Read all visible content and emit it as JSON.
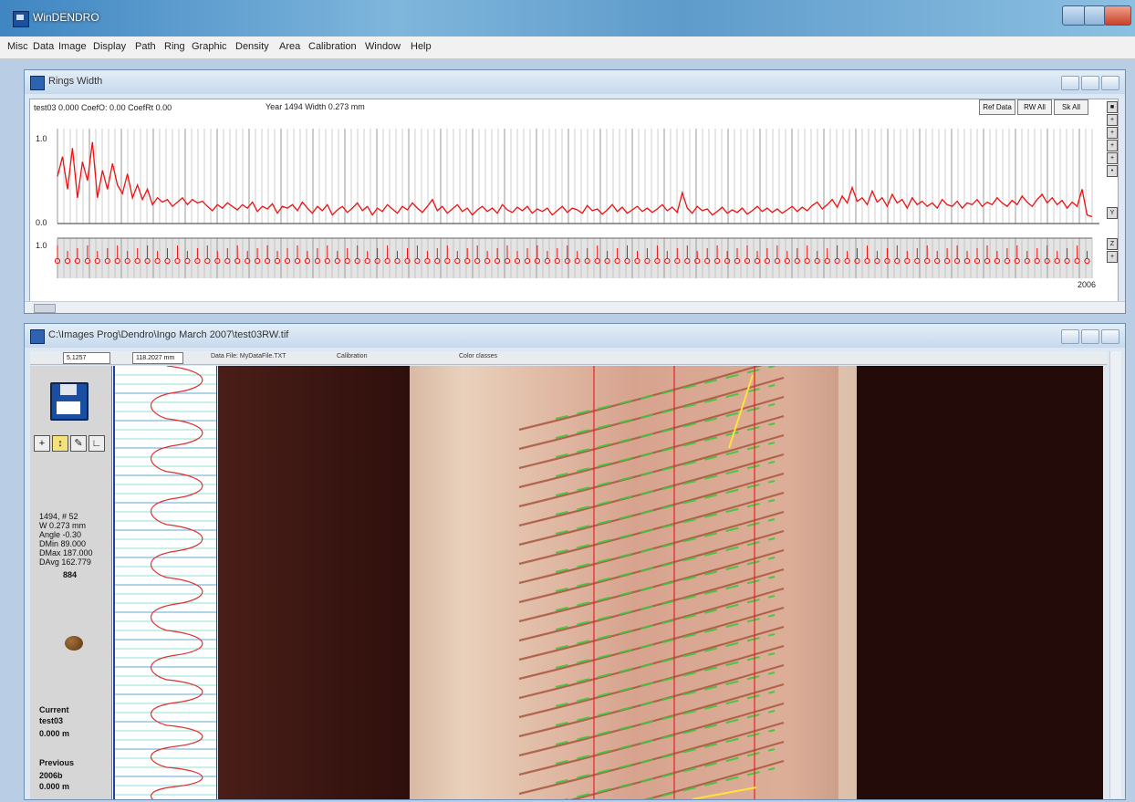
{
  "app": {
    "title": "WinDENDRO"
  },
  "menu": [
    "Misc",
    "Data",
    "Image",
    "Display",
    "Path",
    "Ring",
    "Graphic",
    "Density",
    "Area",
    "Calibration",
    "Window",
    "Help"
  ],
  "rings_window": {
    "title": "Rings Width",
    "header": "test03 0.000  CoefO: 0.00  CoefRt 0.00",
    "year_width": "Year 1494  Width 0.273 mm",
    "buttons": [
      "Ref Data",
      "RW All",
      "Sk All"
    ],
    "y_max_label": "1.0",
    "y_min_label": "0.0",
    "lower_y_label": "1.0",
    "end_year_label": "2006"
  },
  "image_window": {
    "title": "C:\\Images Prog\\Dendro\\Ingo March 2007\\test03RW.tif",
    "field1": "5.1257",
    "field2": "118.2027 mm",
    "datafile": "Data File: MyDataFile.TXT",
    "calibration": "Calibration",
    "color_classes": "Color classes"
  },
  "info": {
    "line1": "1494, # 52",
    "line2": "W 0.273 mm",
    "line3": "Angle -0.30",
    "line4": "DMin 89.000",
    "line5": "DMax 187.000",
    "line6": "DAvg 162.779",
    "line7": "884",
    "current_label": "Current",
    "current_name": "test03",
    "current_value": "0.000 m",
    "previous_label": "Previous",
    "previous_name": "2006b",
    "previous_value": "0.000 m"
  },
  "colors": {
    "series": "#ee1111",
    "ring_mark": "#3cc83c"
  },
  "chart_data": {
    "type": "line",
    "ylim": [
      0,
      1.0
    ],
    "series": [
      {
        "values": [
          0.55,
          0.78,
          0.4,
          0.88,
          0.3,
          0.72,
          0.5,
          0.95,
          0.3,
          0.62,
          0.4,
          0.7,
          0.45,
          0.35,
          0.58,
          0.3,
          0.45,
          0.28,
          0.4,
          0.22,
          0.3,
          0.25,
          0.28,
          0.2,
          0.25,
          0.3,
          0.22,
          0.28,
          0.24,
          0.26,
          0.2,
          0.15,
          0.22,
          0.18,
          0.24,
          0.2,
          0.16,
          0.22,
          0.18,
          0.25,
          0.14,
          0.2,
          0.17,
          0.23,
          0.12,
          0.2,
          0.18,
          0.22,
          0.15,
          0.25,
          0.18,
          0.12,
          0.2,
          0.15,
          0.22,
          0.1,
          0.16,
          0.2,
          0.13,
          0.18,
          0.24,
          0.15,
          0.2,
          0.1,
          0.18,
          0.14,
          0.22,
          0.17,
          0.12,
          0.2,
          0.16,
          0.24,
          0.18,
          0.13,
          0.2,
          0.28,
          0.15,
          0.2,
          0.12,
          0.17,
          0.22,
          0.14,
          0.18,
          0.1,
          0.16,
          0.2,
          0.14,
          0.18,
          0.12,
          0.22,
          0.16,
          0.13,
          0.19,
          0.15,
          0.2,
          0.12,
          0.17,
          0.14,
          0.18,
          0.1,
          0.15,
          0.2,
          0.13,
          0.18,
          0.16,
          0.12,
          0.21,
          0.15,
          0.17,
          0.11,
          0.16,
          0.22,
          0.14,
          0.19,
          0.12,
          0.16,
          0.2,
          0.14,
          0.18,
          0.13,
          0.17,
          0.22,
          0.15,
          0.19,
          0.13,
          0.36,
          0.18,
          0.12,
          0.2,
          0.15,
          0.17,
          0.1,
          0.14,
          0.19,
          0.12,
          0.16,
          0.13,
          0.18,
          0.11,
          0.15,
          0.2,
          0.14,
          0.18,
          0.13,
          0.17,
          0.12,
          0.16,
          0.2,
          0.14,
          0.19,
          0.15,
          0.21,
          0.25,
          0.17,
          0.22,
          0.28,
          0.19,
          0.32,
          0.24,
          0.42,
          0.26,
          0.3,
          0.22,
          0.38,
          0.25,
          0.3,
          0.2,
          0.34,
          0.24,
          0.28,
          0.18,
          0.3,
          0.22,
          0.26,
          0.2,
          0.24,
          0.18,
          0.28,
          0.22,
          0.2,
          0.26,
          0.18,
          0.24,
          0.22,
          0.28,
          0.2,
          0.25,
          0.22,
          0.3,
          0.24,
          0.2,
          0.27,
          0.22,
          0.32,
          0.25,
          0.2,
          0.28,
          0.34,
          0.24,
          0.3,
          0.22,
          0.27,
          0.18,
          0.25,
          0.2,
          0.4,
          0.1,
          0.08
        ]
      }
    ]
  }
}
